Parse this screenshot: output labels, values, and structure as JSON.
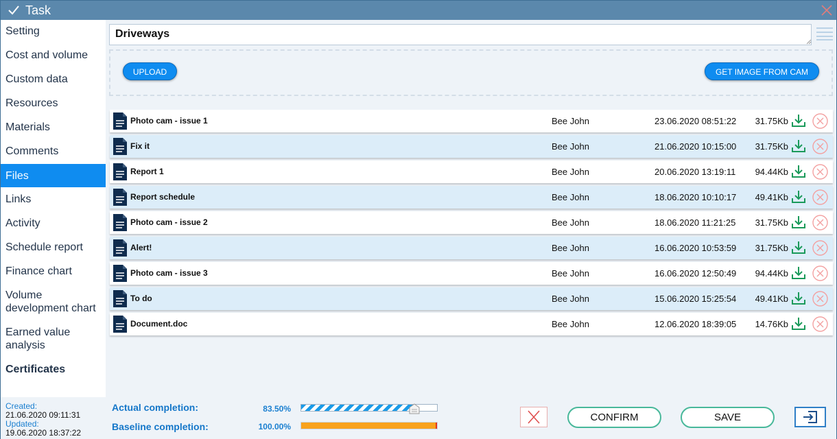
{
  "window": {
    "title": "Task"
  },
  "sidebar": {
    "items": [
      {
        "label": "Setting",
        "active": false,
        "bold": false
      },
      {
        "label": "Cost and volume",
        "active": false,
        "bold": false
      },
      {
        "label": "Custom data",
        "active": false,
        "bold": false
      },
      {
        "label": "Resources",
        "active": false,
        "bold": false
      },
      {
        "label": "Materials",
        "active": false,
        "bold": false
      },
      {
        "label": "Comments",
        "active": false,
        "bold": false
      },
      {
        "label": "Files",
        "active": true,
        "bold": false
      },
      {
        "label": "Links",
        "active": false,
        "bold": false
      },
      {
        "label": "Activity",
        "active": false,
        "bold": false
      },
      {
        "label": "Schedule report",
        "active": false,
        "bold": false
      },
      {
        "label": "Finance chart",
        "active": false,
        "bold": false
      },
      {
        "label": "Volume development chart",
        "active": false,
        "bold": false
      },
      {
        "label": "Earned value analysis",
        "active": false,
        "bold": false
      },
      {
        "label": "Certificates",
        "active": false,
        "bold": true
      }
    ],
    "footer": {
      "created_label": "Created:",
      "created_value": "21.06.2020 09:11:31",
      "updated_label": "Updated:",
      "updated_value": "19.06.2020 18:37:22"
    }
  },
  "main": {
    "task_title": "Driveways",
    "upload_label": "UPLOAD",
    "cam_label": "GET IMAGE FROM CAM",
    "files": [
      {
        "name": "Photo cam - issue 1",
        "owner": "Bee John",
        "date": "23.06.2020 08:51:22",
        "size": "31.75Kb"
      },
      {
        "name": "Fix it",
        "owner": "Bee John",
        "date": "21.06.2020 10:15:00",
        "size": "31.75Kb"
      },
      {
        "name": "Report 1",
        "owner": "Bee John",
        "date": "20.06.2020 13:19:11",
        "size": "94.44Kb"
      },
      {
        "name": "Report schedule",
        "owner": "Bee John",
        "date": "18.06.2020 10:10:17",
        "size": "49.41Kb"
      },
      {
        "name": "Photo cam - issue 2",
        "owner": "Bee John",
        "date": "18.06.2020 11:21:25",
        "size": "31.75Kb"
      },
      {
        "name": "Alert!",
        "owner": "Bee John",
        "date": "16.06.2020 10:53:59",
        "size": "31.75Kb"
      },
      {
        "name": "Photo cam - issue 3",
        "owner": "Bee John",
        "date": "16.06.2020 12:50:49",
        "size": "94.44Kb"
      },
      {
        "name": "To do",
        "owner": "Bee John",
        "date": "15.06.2020 15:25:54",
        "size": "49.41Kb"
      },
      {
        "name": "Document.doc",
        "owner": "Bee John",
        "date": "12.06.2020 18:39:05",
        "size": "14.76Kb"
      }
    ]
  },
  "completion": {
    "actual_label": "Actual completion:",
    "actual_value": "83.50%",
    "actual_fraction": 0.835,
    "baseline_label": "Baseline completion:",
    "baseline_value": "100.00%",
    "baseline_fraction": 1.0
  },
  "actions": {
    "confirm_label": "CONFIRM",
    "save_label": "SAVE"
  },
  "colors": {
    "titlebar": "#5b88ac",
    "accent": "#0f8cf0",
    "row_alt": "#dcedf9",
    "download": "#1a9a5a",
    "delete": "#f3a1a1",
    "baseline": "#f8a21c"
  }
}
